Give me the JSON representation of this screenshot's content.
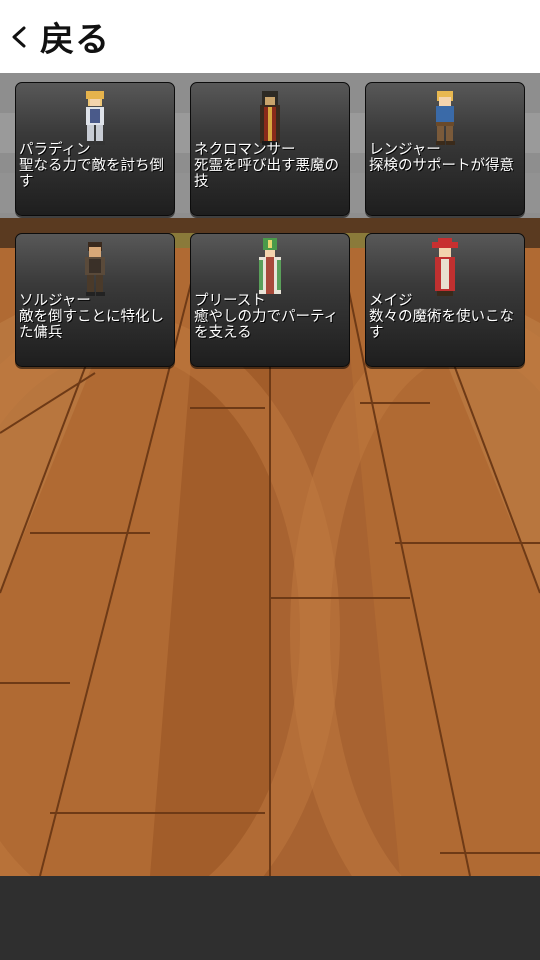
{
  "header": {
    "back_label": "戻る",
    "back_icon": "chevron-left-icon"
  },
  "classes": [
    {
      "id": "paladin",
      "name": "パラディン",
      "description": "聖なる力で敵を討ち倒す",
      "sprite": "paladin-sprite"
    },
    {
      "id": "necromancer",
      "name": "ネクロマンサー",
      "description": "死霊を呼び出す悪魔の技",
      "sprite": "necromancer-sprite"
    },
    {
      "id": "ranger",
      "name": "レンジャー",
      "description": "探検のサポートが得意",
      "sprite": "ranger-sprite"
    },
    {
      "id": "soldier",
      "name": "ソルジャー",
      "description": "敵を倒すことに特化した傭兵",
      "sprite": "soldier-sprite"
    },
    {
      "id": "priest",
      "name": "プリースト",
      "description": "癒やしの力でパーティを支える",
      "sprite": "priest-sprite"
    },
    {
      "id": "mage",
      "name": "メイジ",
      "description": "数々の魔術を使いこなす",
      "sprite": "mage-sprite"
    }
  ],
  "colors": {
    "header_bg": "#ffffff",
    "floor": "#b06a33",
    "wall": "#8f8f8f",
    "footer": "#2f2f2f",
    "card_top": "#585858",
    "card_bottom": "#1e1e1e"
  }
}
